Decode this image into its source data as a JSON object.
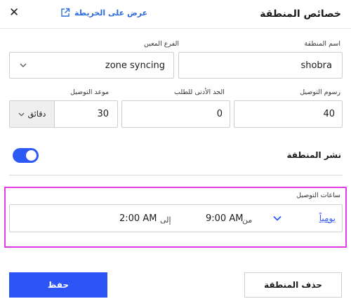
{
  "header": {
    "title": "خصائص المنطقة",
    "map_link_label": "عرض على الخريطة",
    "close_symbol": "✕"
  },
  "zone_name": {
    "label": "اسم المنطقة",
    "value": "shobra"
  },
  "branch": {
    "label": "الفرع المعين",
    "value": "zone syncing"
  },
  "delivery_fee": {
    "label": "رسوم التوصيل",
    "value": "40"
  },
  "min_order": {
    "label": "الحد الأدنى للطلب",
    "value": "0"
  },
  "delivery_time": {
    "label": "موعد التوصيل",
    "value": "30",
    "unit": "دقائق"
  },
  "publish": {
    "label": "نشر المنطقة",
    "enabled": true,
    "accent": "#2d59f5"
  },
  "delivery_hours": {
    "label": "ساعات التوصيل",
    "frequency": "يومياً",
    "from_label": "من",
    "from_time": "9:00 AM",
    "to_label": "إلى",
    "to_time": "2:00 AM",
    "highlight_color": "#e23be4"
  },
  "actions": {
    "save_label": "حفظ",
    "delete_label": "حذف المنطقة",
    "save_color": "#2d55f5"
  }
}
